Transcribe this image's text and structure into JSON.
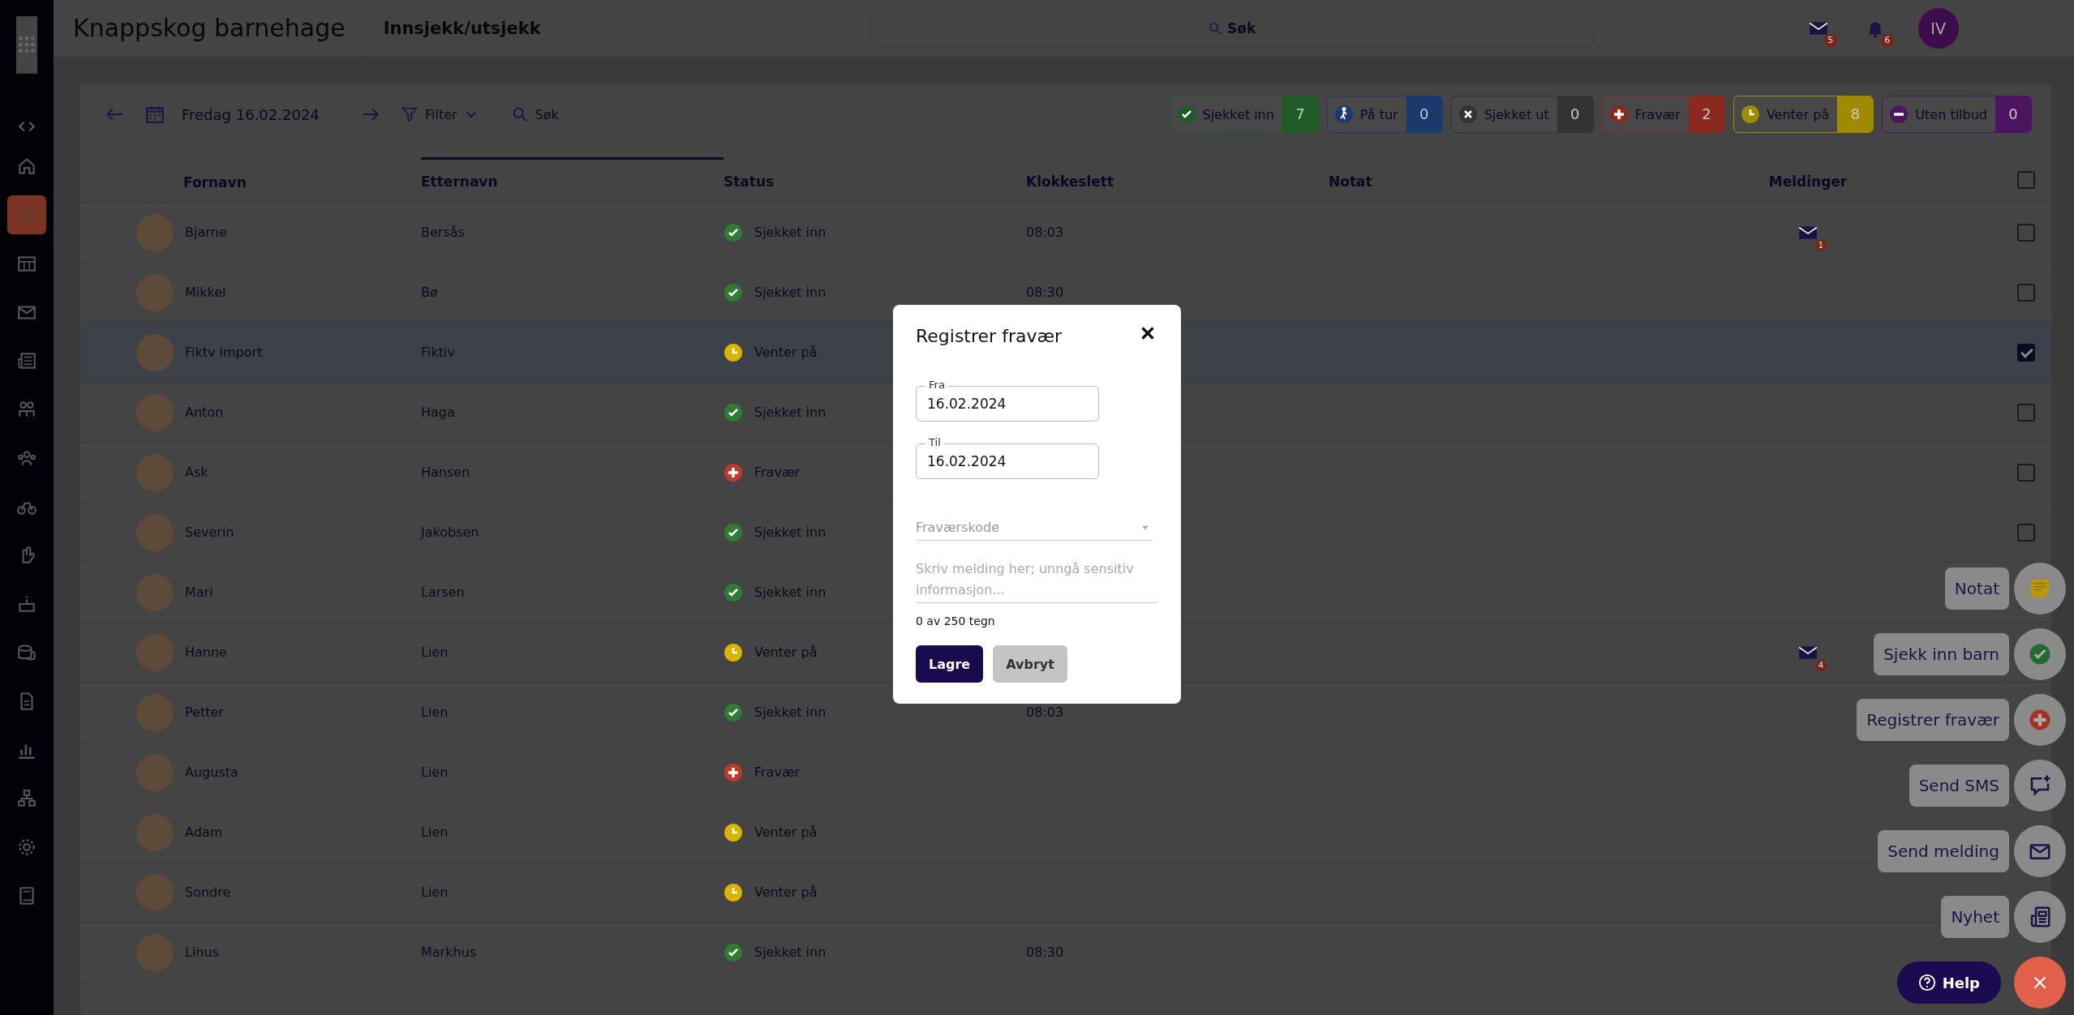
{
  "header": {
    "org": "Knappskog barnehage",
    "page": "Innsjekk/utsjekk",
    "search": {
      "placeholder": "Søk"
    },
    "mail_badge": "5",
    "bell_badge": "6",
    "avatar": "IV"
  },
  "sidebar": {
    "items": [
      {
        "selected": false
      },
      {
        "selected": true
      },
      {
        "selected": false
      },
      {
        "selected": false
      },
      {
        "selected": false
      },
      {
        "selected": false
      },
      {
        "selected": false
      },
      {
        "selected": false
      },
      {
        "selected": false
      },
      {
        "selected": false
      },
      {
        "selected": false
      },
      {
        "selected": false
      },
      {
        "selected": false
      },
      {
        "selected": false
      },
      {
        "selected": false
      },
      {
        "selected": false
      }
    ]
  },
  "toolbar": {
    "date": "Fredag 16.02.2024",
    "filter": "Filter",
    "search": "Søk"
  },
  "chips": [
    {
      "kind": "checked_in",
      "label": "Sjekket inn",
      "count": "7",
      "color": "#1f5a27"
    },
    {
      "kind": "trip",
      "label": "På tur",
      "count": "0",
      "color": "#1a3a6e"
    },
    {
      "kind": "checked_out",
      "label": "Sjekket ut",
      "count": "0",
      "color": "#333333"
    },
    {
      "kind": "absent",
      "label": "Fravær",
      "count": "2",
      "color": "#8a2a1e"
    },
    {
      "kind": "waiting",
      "label": "Venter på",
      "count": "8",
      "color": "#a08a00"
    },
    {
      "kind": "no_offer",
      "label": "Uten tilbud",
      "count": "0",
      "color": "#4a1460"
    }
  ],
  "table": {
    "columns": [
      {
        "label": "Fornavn",
        "sorted": false
      },
      {
        "label": "Etternavn",
        "sorted": true
      },
      {
        "label": "Status",
        "sorted": false
      },
      {
        "label": "Klokkeslett",
        "sorted": false
      },
      {
        "label": "Notat",
        "sorted": false
      },
      {
        "label": "Meldinger",
        "sorted": false
      }
    ],
    "select_all": false,
    "rows": [
      {
        "first": "Bjarne",
        "last": "Bersås",
        "status": {
          "kind": "checked_in",
          "label": "Sjekket inn"
        },
        "time": "08:03",
        "messages": "1",
        "selected": false
      },
      {
        "first": "Mikkel",
        "last": "Bø",
        "status": {
          "kind": "checked_in",
          "label": "Sjekket inn"
        },
        "time": "08:30",
        "selected": false
      },
      {
        "first": "Fiktv import",
        "last": "Fiktiv",
        "status": {
          "kind": "waiting",
          "label": "Venter på"
        },
        "selected": true
      },
      {
        "first": "Anton",
        "last": "Haga",
        "status": {
          "kind": "checked_in",
          "label": "Sjekket inn"
        },
        "selected": false
      },
      {
        "first": "Ask",
        "last": "Hansen",
        "status": {
          "kind": "absent",
          "label": "Fravær"
        },
        "selected": false
      },
      {
        "first": "Severin",
        "last": "Jakobsen",
        "status": {
          "kind": "checked_in",
          "label": "Sjekket inn"
        },
        "selected": false
      },
      {
        "first": "Mari",
        "last": "Larsen",
        "status": {
          "kind": "checked_in",
          "label": "Sjekket inn"
        }
      },
      {
        "first": "Hanne",
        "last": "Lien",
        "status": {
          "kind": "waiting",
          "label": "Venter på"
        },
        "messages": "4"
      },
      {
        "first": "Petter",
        "last": "Lien",
        "status": {
          "kind": "checked_in",
          "label": "Sjekket inn"
        },
        "time": "08:03"
      },
      {
        "first": "Augusta",
        "last": "Lien",
        "status": {
          "kind": "absent",
          "label": "Fravær"
        }
      },
      {
        "first": "Adam",
        "last": "Lien",
        "status": {
          "kind": "waiting",
          "label": "Venter på"
        }
      },
      {
        "first": "Sondre",
        "last": "Lien",
        "status": {
          "kind": "waiting",
          "label": "Venter på"
        }
      },
      {
        "first": "Linus",
        "last": "Markhus",
        "status": {
          "kind": "checked_in",
          "label": "Sjekket inn"
        },
        "time": "08:30"
      }
    ]
  },
  "dialog": {
    "title": "Registrer fravær",
    "from": {
      "label": "Fra",
      "value": "16.02.2024"
    },
    "to": {
      "label": "Til",
      "value": "16.02.2024"
    },
    "code": {
      "placeholder": "Fraværskode"
    },
    "message": {
      "placeholder": "Skriv melding her; unngå sensitiv informasjon..."
    },
    "counter": "0 av 250 tegn",
    "buttons": [
      "Lagre",
      "Avbryt"
    ]
  },
  "actions": [
    {
      "kind": "note",
      "label": "Notat"
    },
    {
      "kind": "check_in",
      "label": "Sjekk inn barn"
    },
    {
      "kind": "absence",
      "label": "Registrer fravær"
    },
    {
      "kind": "sms",
      "label": "Send SMS"
    },
    {
      "kind": "message",
      "label": "Send melding"
    },
    {
      "kind": "news",
      "label": "Nyhet"
    }
  ],
  "help": "Help"
}
